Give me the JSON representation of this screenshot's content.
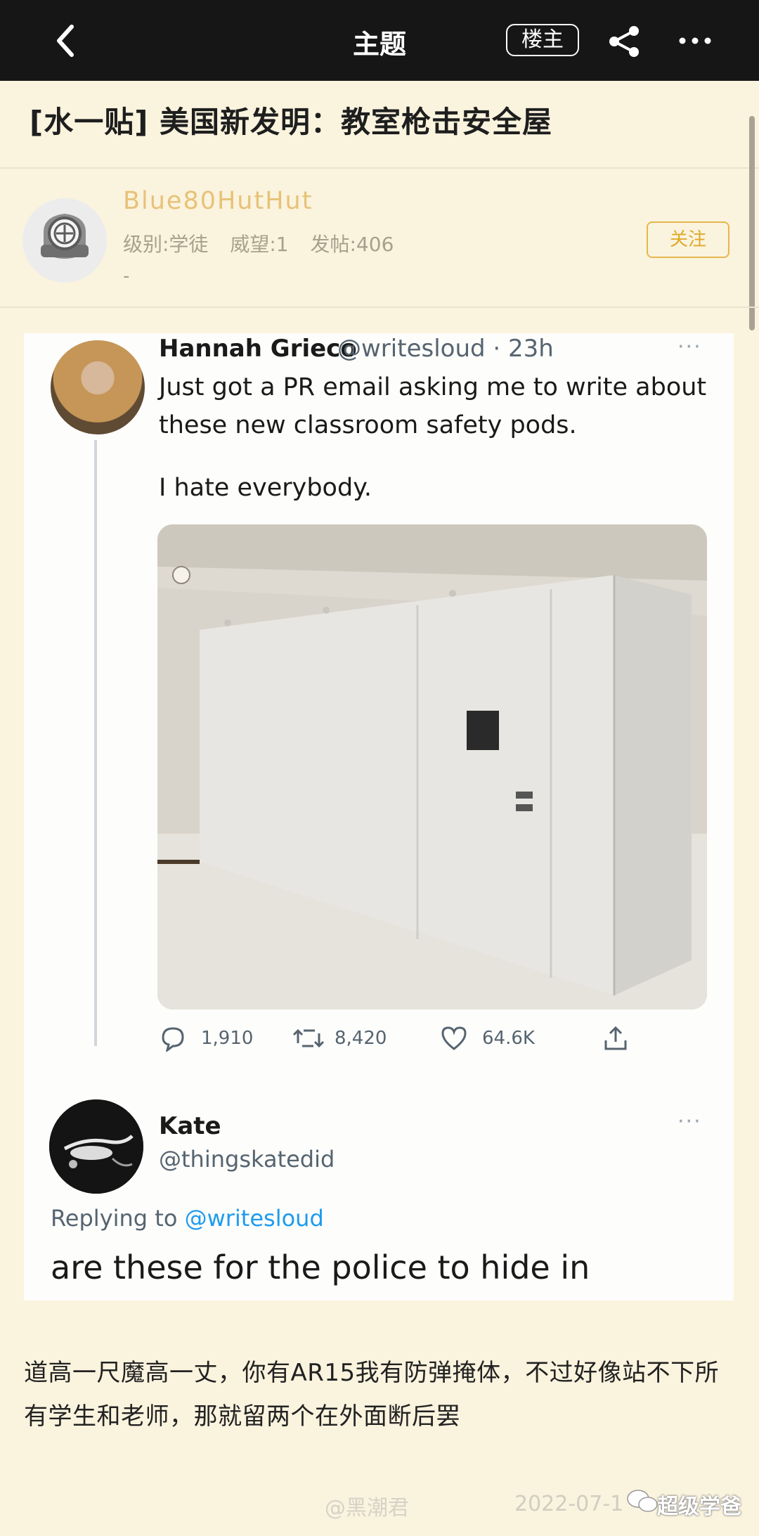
{
  "topbar": {
    "title": "主题",
    "op_badge": "楼主"
  },
  "post": {
    "title": "[水一贴] 美国新发明：教室枪击安全屋",
    "author": {
      "username": "Blue80HutHut",
      "level": "级别:学徒",
      "reputation": "威望:1",
      "posts": "发帖:406",
      "signature": "-"
    },
    "follow_label": "关注",
    "body": "道高一尺魔高一丈，你有AR15我有防弹掩体，不过好像站不下所有学生和老师，那就留两个在外面断后罢",
    "date": "2022-07-1"
  },
  "tweet": {
    "name": "Hannah Grieco",
    "handle_time": "@writesloud · 23h",
    "text": "Just got a PR email asking me to write about these new classroom safety pods.",
    "text2": "I hate everybody.",
    "replies": "1,910",
    "retweets": "8,420",
    "likes": "64.6K",
    "more": "···"
  },
  "reply": {
    "name": "Kate",
    "handle": "@thingskatedid",
    "replying_prefix": "Replying to ",
    "replying_to": "@writesloud",
    "text": "are these for the police to hide in",
    "more": "···"
  },
  "watermarks": {
    "weibo": "@黑潮君",
    "wechat": "超级学爸"
  },
  "icons": [
    "back-arrow-icon",
    "share-icon",
    "more-icon",
    "reply-icon",
    "retweet-icon",
    "like-icon",
    "upload-icon"
  ]
}
